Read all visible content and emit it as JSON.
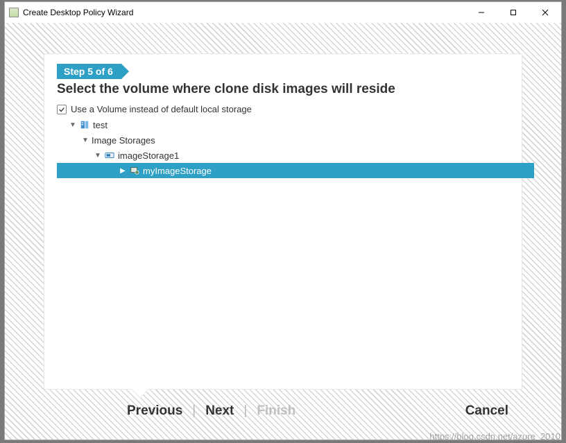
{
  "window": {
    "title": "Create Desktop Policy Wizard"
  },
  "step": {
    "label": "Step 5 of 6"
  },
  "heading": "Select the volume where clone disk images will reside",
  "checkbox": {
    "label": "Use a Volume instead of default local storage",
    "checked": true
  },
  "tree": {
    "root": {
      "label": "test",
      "child": {
        "label": "Image Storages",
        "child": {
          "label": "imageStorage1",
          "child": {
            "label": "myImageStorage",
            "selected": true
          }
        }
      }
    }
  },
  "footer": {
    "previous": "Previous",
    "next": "Next",
    "finish": "Finish",
    "cancel": "Cancel"
  },
  "watermark": "https://blog.csdn.net/azure_2010"
}
